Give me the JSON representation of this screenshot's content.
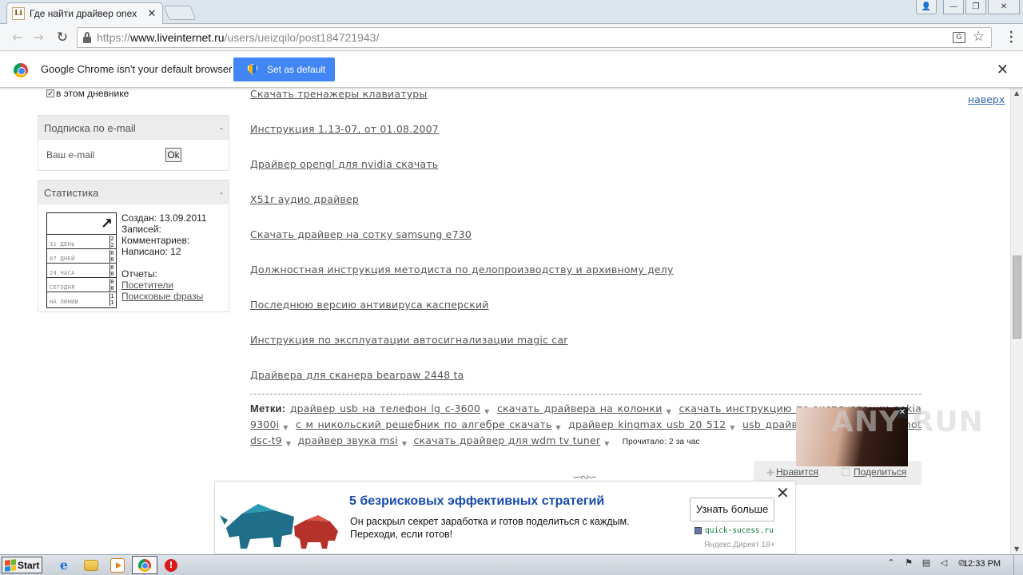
{
  "browser": {
    "tab_title": "Где найти драйвер onext ",
    "url_scheme": "https://",
    "url_host": "www.liveinternet.ru",
    "url_path": "/users/ueizqilo/post184721943/"
  },
  "infobar": {
    "message": "Google Chrome isn't your default browser",
    "button": "Set as default"
  },
  "sidebar": {
    "checkbox_label": "в этом дневнике",
    "subscribe": {
      "title": "Подписка по e-mail",
      "collapse": "-",
      "email_label": "Ваш e-mail",
      "ok_button": "Ok"
    },
    "stats": {
      "title": "Статистика",
      "collapse": "-",
      "counter_rows": [
        {
          "label": "31 ДЕНЬ",
          "v1": "2",
          "v2": "2"
        },
        {
          "label": "07 ДНЕЙ",
          "v1": "0",
          "v2": "0"
        },
        {
          "label": "24 ЧАСА",
          "v1": "0",
          "v2": "0"
        },
        {
          "label": "СЕГОДНЯ",
          "v1": "0",
          "v2": "0"
        },
        {
          "label": "НА ЛИНИИ",
          "v1": "1",
          "v2": "1"
        }
      ],
      "created": "Создан: 13.09.2011",
      "posts": "Записей:",
      "comments": "Комментариев:",
      "written": "Написано: 12",
      "reports": "Отчеты:",
      "visitors_link": "Посетители",
      "search_link": "Поисковые фразы"
    }
  },
  "main": {
    "top_link": "наверх",
    "links": [
      "Скачать тренажеры клавиатуры",
      "Инструкция 1.13-07, от 01.08.2007",
      "Драйвер opengl для nvidia скачать",
      "X51r аудио драйвер",
      "Скачать драйвер на сотку samsung e730",
      "Должностная инструкция методиста по делопроизводству и архивному делу",
      "Последнюю версию антивируса касперский",
      "Инструкция по эксплуатации автосигнализации magic car",
      "Драйвера для сканера bearpaw 2448 ta"
    ],
    "tags_label": "Метки:",
    "tags": [
      "драйвер usb на телефон lg c-3600",
      "скачать драйвера на колонки",
      "скачать инструкцию по эксплуатации nokia 9300i",
      "с м никольский решебник по алгебре скачать",
      "драйвер kingmax usb 20 512",
      "usb драйвер для sony cyber-shot dsc-t9",
      "драйвер звука msi",
      "скачать драйвер для wdm tv tuner"
    ],
    "read_count": "Прочитало: 2 за час",
    "like": "Нравится",
    "share": "Поделиться"
  },
  "ad": {
    "title": "5 безрисковых эффективных стратегий",
    "line1": "Он раскрыл секрет заработка и готов поделиться с каждым.",
    "line2": "Переходи, если готов!",
    "button": "Узнать больше",
    "domain": "quick-sucess.ru",
    "footer": "Яндекс.Директ 18+"
  },
  "watermark": "ANY RUN",
  "taskbar": {
    "start": "Start",
    "clock": "12:33 PM"
  },
  "colors": {
    "infobar_button": "#4285f4",
    "ad_title": "#1a4ab0",
    "top_link": "#3366aa"
  }
}
